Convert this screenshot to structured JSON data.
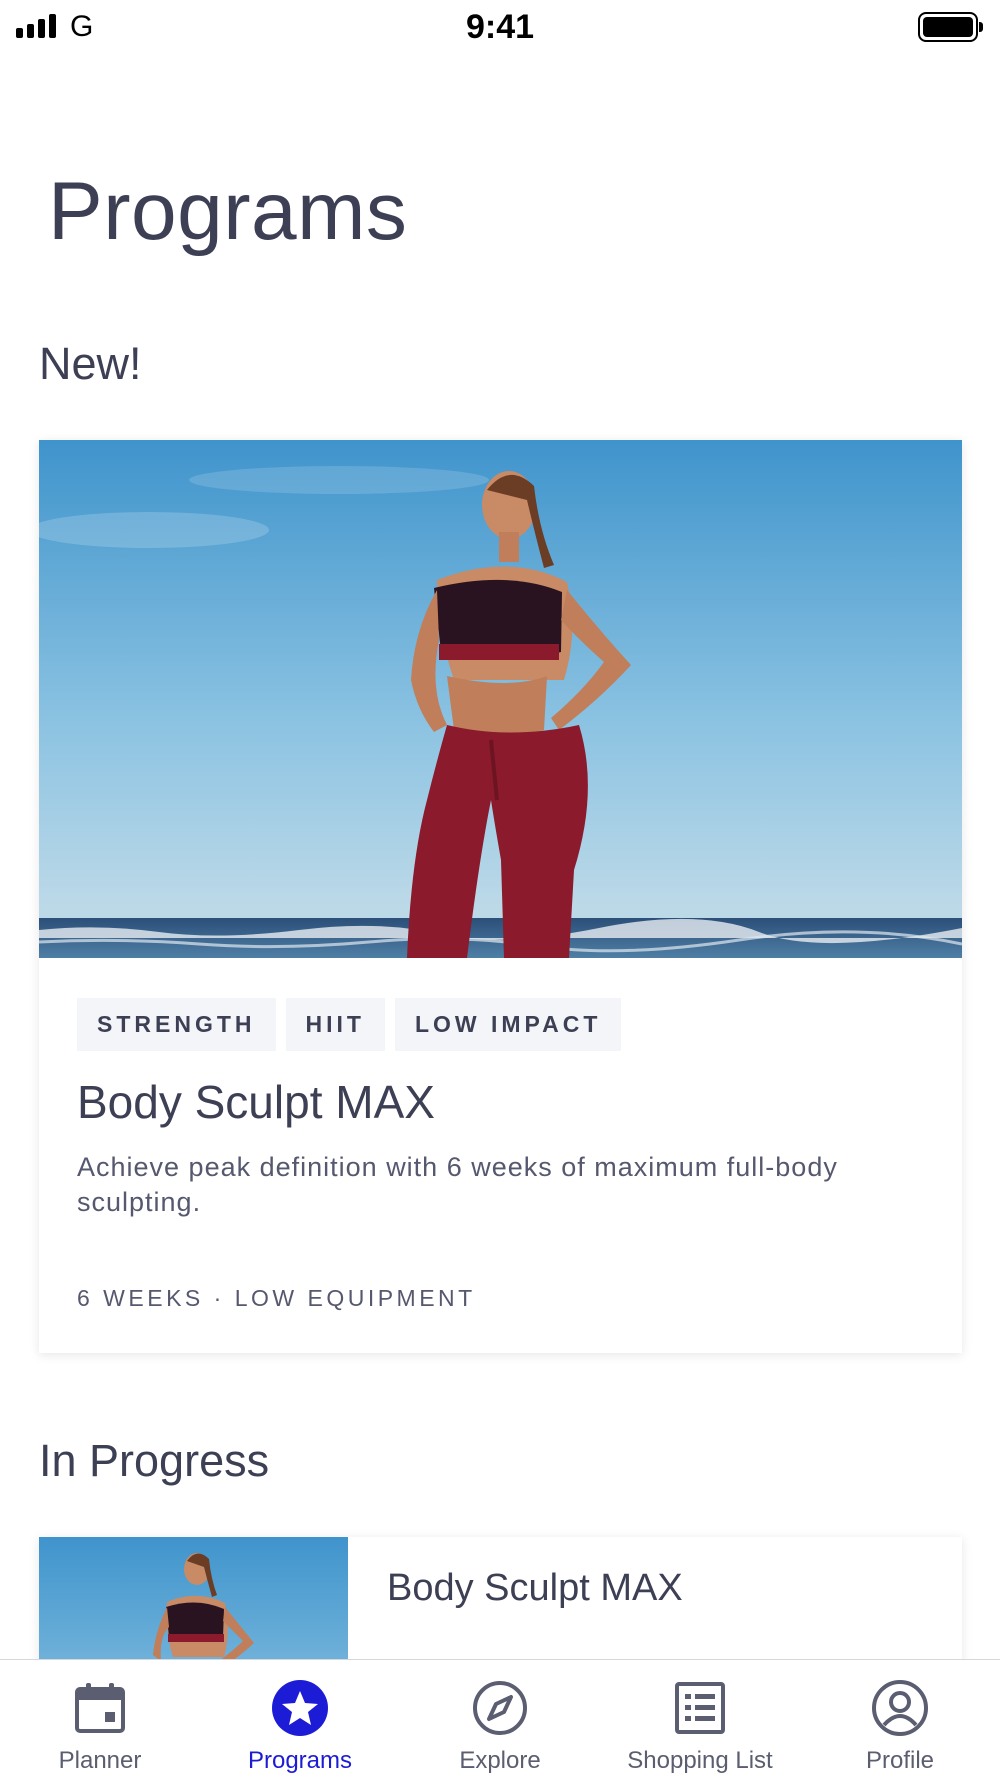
{
  "status_bar": {
    "carrier": "G",
    "time": "9:41"
  },
  "page": {
    "title": "Programs"
  },
  "sections": {
    "new_title": "New!",
    "in_progress_title": "In Progress"
  },
  "featured_program": {
    "tags": [
      "STRENGTH",
      "HIIT",
      "LOW IMPACT"
    ],
    "title": "Body Sculpt MAX",
    "description": "Achieve peak definition with 6 weeks of maximum full-body sculpting.",
    "meta": "6 WEEKS · LOW EQUIPMENT",
    "image": "woman-fitness-beach-photo"
  },
  "in_progress_program": {
    "title": "Body Sculpt MAX",
    "image": "woman-fitness-beach-photo"
  },
  "tab_bar": {
    "tabs": [
      {
        "label": "Planner",
        "icon": "calendar-icon",
        "active": false
      },
      {
        "label": "Programs",
        "icon": "star-icon",
        "active": true
      },
      {
        "label": "Explore",
        "icon": "compass-icon",
        "active": false
      },
      {
        "label": "Shopping List",
        "icon": "list-icon",
        "active": false
      },
      {
        "label": "Profile",
        "icon": "profile-icon",
        "active": false
      }
    ]
  },
  "colors": {
    "text": "#3d3f55",
    "accent": "#1c1cd6",
    "tag_bg": "#f4f5f8",
    "inactive_icon": "#5b5d70"
  }
}
